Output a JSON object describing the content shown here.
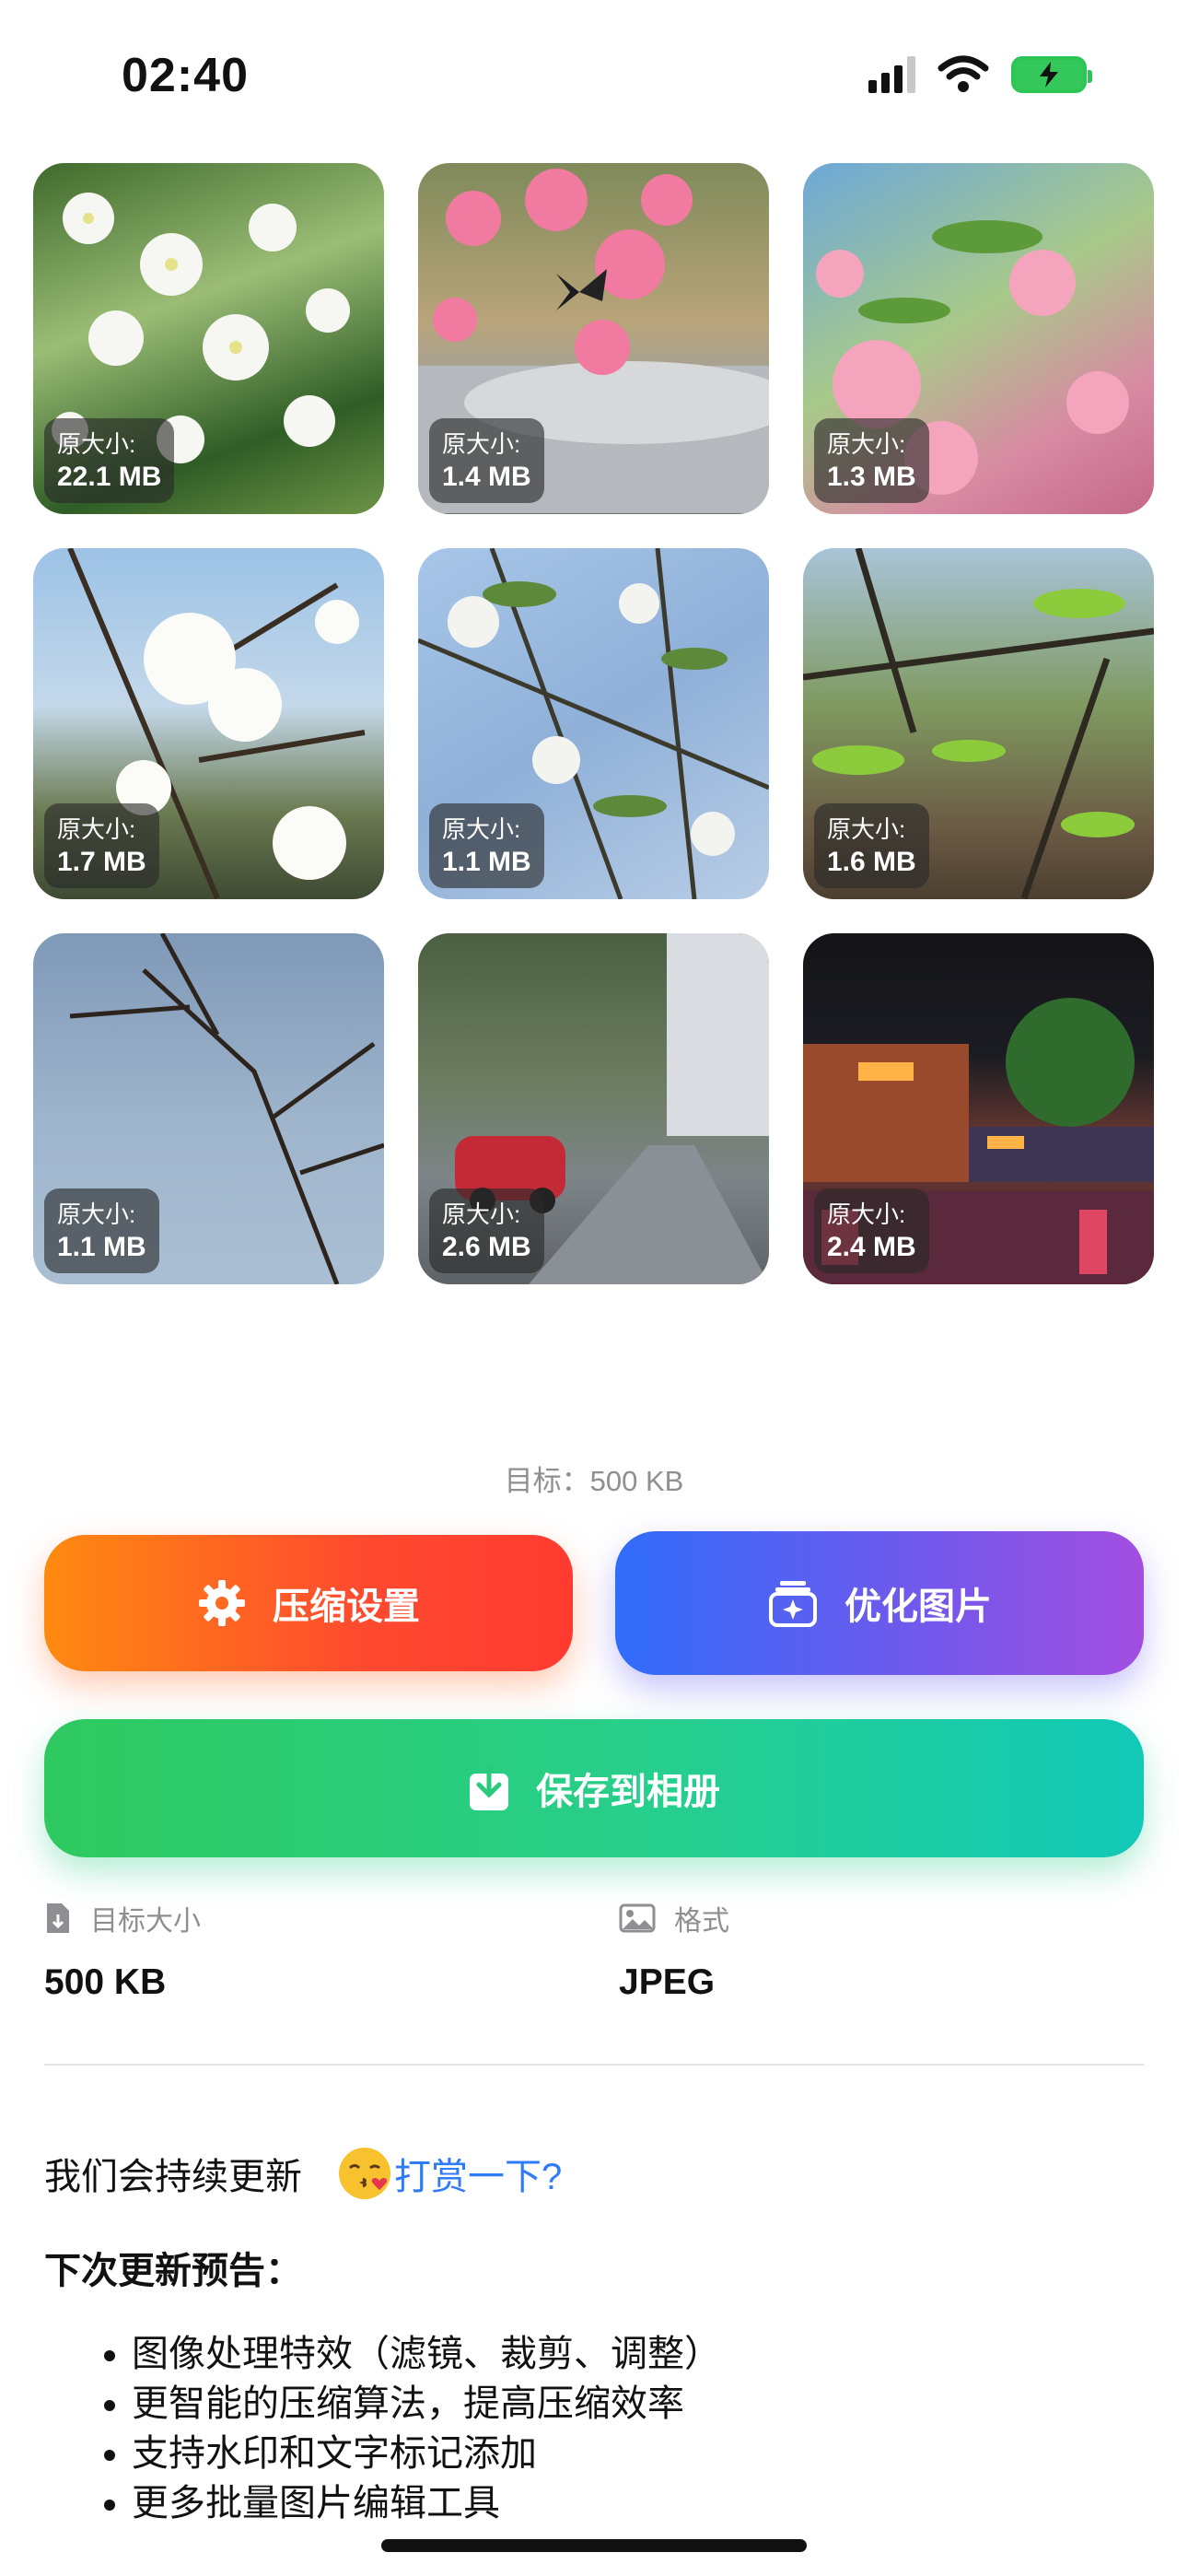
{
  "status_bar": {
    "time": "02:40"
  },
  "photos": [
    {
      "label": "原大小:",
      "size": "22.1 MB"
    },
    {
      "label": "原大小:",
      "size": "1.4 MB"
    },
    {
      "label": "原大小:",
      "size": "1.3 MB"
    },
    {
      "label": "原大小:",
      "size": "1.7 MB"
    },
    {
      "label": "原大小:",
      "size": "1.1 MB"
    },
    {
      "label": "原大小:",
      "size": "1.6 MB"
    },
    {
      "label": "原大小:",
      "size": "1.1 MB"
    },
    {
      "label": "原大小:",
      "size": "2.6 MB"
    },
    {
      "label": "原大小:",
      "size": "2.4 MB"
    }
  ],
  "target_hint": "目标：500 KB",
  "buttons": {
    "compress_settings": "压缩设置",
    "optimize": "优化图片",
    "save": "保存到相册"
  },
  "info": {
    "target_size_label": "目标大小",
    "target_size_value": "500 KB",
    "format_label": "格式",
    "format_value": "JPEG"
  },
  "update": {
    "text": "我们会持续更新",
    "link": "打赏一下?",
    "preview_title": "下次更新预告：",
    "items": [
      "图像处理特效（滤镜、裁剪、调整）",
      "更智能的压缩算法，提高压缩效率",
      "支持水印和文字标记添加",
      "更多批量图片编辑工具"
    ]
  },
  "colors": {
    "compress_gradient": [
      "#ff8a10",
      "#ff3a30"
    ],
    "optimize_gradient": [
      "#2f6dfa",
      "#a24ee0"
    ],
    "save_gradient": [
      "#2ec95f",
      "#12c9b8"
    ],
    "link": "#2f7cf6"
  }
}
